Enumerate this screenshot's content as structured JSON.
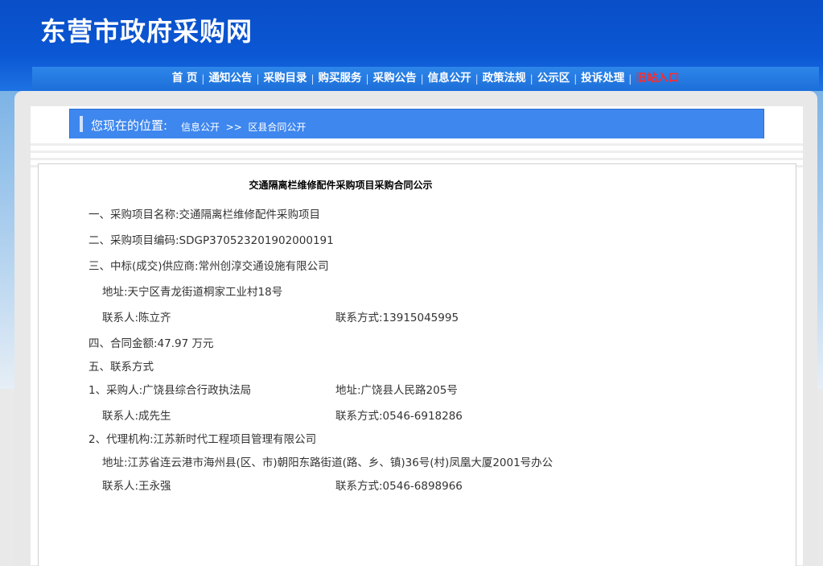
{
  "header": {
    "site_title": "东营市政府采购网"
  },
  "nav": {
    "items": [
      "首 页",
      "通知公告",
      "采购目录",
      "购买服务",
      "采购公告",
      "信息公开",
      "政策法规",
      "公示区",
      "投诉处理",
      "旧站入口"
    ]
  },
  "breadcrumb": {
    "label": "您现在的位置:",
    "level1": "信息公开",
    "separator": ">>",
    "level2": "区县合同公开"
  },
  "document": {
    "title": "交通隔离栏维修配件采购项目采购合同公示",
    "project_name": "一、采购项目名称:交通隔离栏维修配件采购项目",
    "project_code": "二、采购项目编码:SDGP370523201902000191",
    "supplier": "三、中标(成交)供应商:常州创淳交通设施有限公司",
    "supplier_address": "地址:天宁区青龙街道桐家工业村18号",
    "supplier_contact": "联系人:陈立齐",
    "supplier_phone": "联系方式:13915045995",
    "amount": "四、合同金额:47.97 万元",
    "contact_heading": "五、联系方式",
    "purchaser": "1、采购人:广饶县综合行政执法局",
    "purchaser_address": "地址:广饶县人民路205号",
    "purchaser_contact": "联系人:成先生",
    "purchaser_phone": "联系方式:0546-6918286",
    "agency": "2、代理机构:江苏新时代工程项目管理有限公司",
    "agency_address": "地址:江苏省连云港市海州县(区、市)朝阳东路街道(路、乡、镇)36号(村)凤凰大厦2001号办公",
    "agency_contact": "联系人:王永强",
    "agency_phone": "联系方式:0546-6898966"
  }
}
